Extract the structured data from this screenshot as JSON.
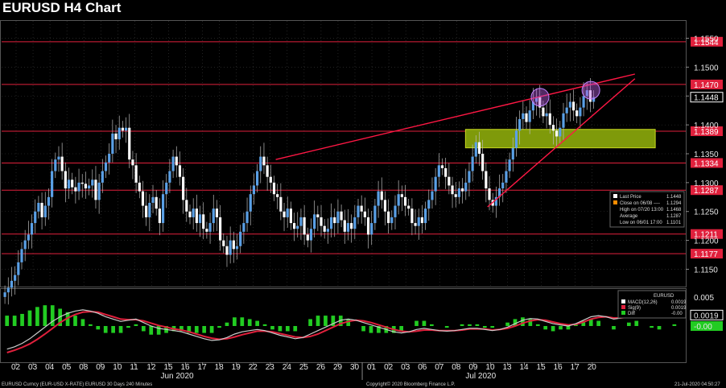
{
  "title": "EURUSD H4 Chart",
  "chart_data": {
    "type": "candlestick",
    "symbol": "EURUSD",
    "timeframe": "H4",
    "y_range": [
      1.112,
      1.158
    ],
    "y_ticks": [
      "1.1150",
      "1.1200",
      "1.1250",
      "1.1300",
      "1.1350",
      "1.1400",
      "1.1450",
      "1.1500",
      "1.1550"
    ],
    "x_ticks": [
      "02",
      "03",
      "04",
      "05",
      "08",
      "09",
      "10",
      "11",
      "12",
      "15",
      "16",
      "17",
      "18",
      "19",
      "22",
      "23",
      "24",
      "25",
      "26",
      "29",
      "30",
      "01",
      "02",
      "03",
      "06",
      "07",
      "08",
      "09",
      "10",
      "13",
      "14",
      "15",
      "16",
      "17",
      "20"
    ],
    "month_labels": [
      {
        "text": "Jun 2020",
        "day_index": 9
      },
      {
        "text": "Jul 2020",
        "day_index": 27
      }
    ],
    "horizontal_levels": [
      {
        "label": "1.1544",
        "value": 1.1544,
        "color": "#e0203c"
      },
      {
        "label": "1.1470",
        "value": 1.147,
        "color": "#e0203c"
      },
      {
        "label": "1.1389",
        "value": 1.1389,
        "color": "#e0203c"
      },
      {
        "label": "1.1334",
        "value": 1.1334,
        "color": "#e0203c"
      },
      {
        "label": "1.1287",
        "value": 1.1287,
        "color": "#e0203c"
      },
      {
        "label": "1.1211",
        "value": 1.1211,
        "color": "#e0203c"
      },
      {
        "label": "1.1177",
        "value": 1.1177,
        "color": "#e0203c"
      }
    ],
    "last_price": {
      "label": "1.1448",
      "value": 1.1448
    },
    "trendlines": [
      {
        "from": {
          "day_index": 15.8,
          "value": 1.134
        },
        "to": {
          "day_index": 37.0,
          "value": 1.1488
        }
      },
      {
        "from": {
          "day_index": 28.3,
          "value": 1.1258
        },
        "to": {
          "day_index": 37.0,
          "value": 1.148
        }
      }
    ],
    "support_zone": {
      "from_day_index": 27.0,
      "to_day_index": 38.2,
      "low": 1.137,
      "high": 1.1388,
      "color": "#7f9a0a"
    },
    "highlight_circles": [
      {
        "day_index": 31.4,
        "value": 1.1448
      },
      {
        "day_index": 34.4,
        "value": 1.146
      }
    ],
    "close_series": [
      1.111,
      1.1118,
      1.113,
      1.114,
      1.1162,
      1.1185,
      1.12,
      1.121,
      1.123,
      1.125,
      1.1265,
      1.124,
      1.126,
      1.1275,
      1.132,
      1.134,
      1.1345,
      1.132,
      1.129,
      1.1305,
      1.1292,
      1.1285,
      1.13,
      1.1298,
      1.129,
      1.1295,
      1.1305,
      1.127,
      1.13,
      1.132,
      1.1335,
      1.135,
      1.1385,
      1.1375,
      1.1395,
      1.139,
      1.1395,
      1.134,
      1.133,
      1.13,
      1.1285,
      1.126,
      1.124,
      1.1265,
      1.1275,
      1.1255,
      1.123,
      1.128,
      1.13,
      1.132,
      1.1345,
      1.133,
      1.131,
      1.127,
      1.125,
      1.124,
      1.1255,
      1.123,
      1.1245,
      1.122,
      1.1215,
      1.123,
      1.1255,
      1.124,
      1.12,
      1.119,
      1.1175,
      1.12,
      1.1185,
      1.119,
      1.1215,
      1.123,
      1.125,
      1.128,
      1.1295,
      1.132,
      1.1345,
      1.133,
      1.131,
      1.13,
      1.128,
      1.1275,
      1.125,
      1.124,
      1.1255,
      1.123,
      1.122,
      1.1225,
      1.124,
      1.121,
      1.12,
      1.122,
      1.1245,
      1.124,
      1.1225,
      1.1215,
      1.122,
      1.124,
      1.123,
      1.125,
      1.1235,
      1.1215,
      1.123,
      1.122,
      1.124,
      1.126,
      1.125,
      1.124,
      1.121,
      1.123,
      1.126,
      1.1285,
      1.127,
      1.125,
      1.123,
      1.124,
      1.126,
      1.128,
      1.1275,
      1.126,
      1.1255,
      1.123,
      1.1225,
      1.124,
      1.123,
      1.1255,
      1.127,
      1.1285,
      1.131,
      1.133,
      1.1325,
      1.131,
      1.1295,
      1.128,
      1.1275,
      1.129,
      1.1285,
      1.13,
      1.132,
      1.1345,
      1.137,
      1.135,
      1.132,
      1.129,
      1.127,
      1.126,
      1.1275,
      1.129,
      1.13,
      1.132,
      1.134,
      1.136,
      1.139,
      1.141,
      1.142,
      1.1405,
      1.1425,
      1.144,
      1.1448,
      1.143,
      1.1415,
      1.142,
      1.14,
      1.139,
      1.138,
      1.1395,
      1.142,
      1.143,
      1.144,
      1.1425,
      1.1415,
      1.143,
      1.145,
      1.146,
      1.144,
      1.1448
    ],
    "macd_axis": [
      {
        "label": "0.005",
        "value": 0.005
      },
      {
        "label": "0.0019",
        "value": 0.0019
      },
      {
        "label": "-0.00",
        "value": 0.0
      }
    ],
    "macd_series": [
      -0.004,
      -0.0036,
      -0.003,
      -0.0022,
      -0.0012,
      -0.0002,
      0.0008,
      0.0016,
      0.0022,
      0.0026,
      0.0028,
      0.0026,
      0.0022,
      0.0016,
      0.0012,
      0.0008,
      0.001,
      0.0012,
      0.0006,
      0.0,
      -0.0004,
      -0.0006,
      -0.0008,
      -0.001,
      -0.0014,
      -0.0018,
      -0.0022,
      -0.0025,
      -0.0024,
      -0.002,
      -0.0014,
      -0.001,
      -0.0008,
      -0.0006,
      -0.0008,
      -0.0012,
      -0.0016,
      -0.0019,
      -0.0022,
      -0.002,
      -0.0014,
      -0.0008,
      -0.0002,
      0.0004,
      0.001,
      0.0012,
      0.001,
      0.0006,
      0.0002,
      -0.0002,
      -0.0006,
      -0.001,
      -0.0012,
      -0.001,
      -0.0006,
      -0.0004,
      -0.0006,
      -0.0008,
      -0.0009,
      -0.0008,
      -0.0006,
      -0.0004,
      -0.0004,
      -0.0006,
      -0.0008,
      -0.0006,
      -0.0002,
      0.0004,
      0.001,
      0.0013,
      0.0012,
      0.0008,
      0.0004,
      0.0002,
      0.0,
      0.0004,
      0.001,
      0.0016,
      0.0018,
      0.0016,
      0.0012,
      0.0014,
      0.0018,
      0.0022,
      0.002,
      0.0018,
      0.0016,
      0.0018,
      0.002,
      0.0019
    ],
    "signal_series": [
      -0.0046,
      -0.0042,
      -0.0037,
      -0.0031,
      -0.0023,
      -0.0014,
      -0.0004,
      0.0006,
      0.0014,
      0.002,
      0.0024,
      0.0025,
      0.0024,
      0.002,
      0.0016,
      0.0012,
      0.0011,
      0.0011,
      0.0009,
      0.0005,
      0.0001,
      -0.0002,
      -0.0005,
      -0.0007,
      -0.001,
      -0.0014,
      -0.0018,
      -0.0021,
      -0.0023,
      -0.0022,
      -0.0019,
      -0.0015,
      -0.0012,
      -0.0009,
      -0.0009,
      -0.001,
      -0.0013,
      -0.0016,
      -0.0019,
      -0.002,
      -0.0018,
      -0.0014,
      -0.0008,
      -0.0002,
      0.0004,
      0.0008,
      0.001,
      0.0009,
      0.0006,
      0.0002,
      -0.0002,
      -0.0006,
      -0.0009,
      -0.001,
      -0.0009,
      -0.0007,
      -0.0007,
      -0.0008,
      -0.0008,
      -0.0008,
      -0.0007,
      -0.0005,
      -0.0005,
      -0.0005,
      -0.0007,
      -0.0006,
      -0.0004,
      0.0,
      0.0005,
      0.0009,
      0.0011,
      0.001,
      0.0007,
      0.0004,
      0.0002,
      0.0003,
      0.0007,
      0.0012,
      0.0015,
      0.0016,
      0.0014,
      0.0014,
      0.0016,
      0.0019,
      0.002,
      0.0019,
      0.0018,
      0.0018,
      0.0019,
      0.0019
    ],
    "legend_price": [
      {
        "label": "Last Price",
        "value": "1.1448",
        "swatch": "#ffffff"
      },
      {
        "label": "Close on 06/08 ---- ",
        "value": "1.1294",
        "swatch": "#ff8c00"
      },
      {
        "label": "High on 07/20 13:00",
        "value": "1.1468",
        "swatch": ""
      },
      {
        "label": "Average",
        "value": "1.1287",
        "swatch": ""
      },
      {
        "label": "Low on 06/01 17:00",
        "value": "1.1101",
        "swatch": ""
      }
    ],
    "legend_macd_title": "EURUSD",
    "legend_macd": [
      {
        "label": "MACD(12,26)",
        "value": "0.0019",
        "swatch": "#ffffff"
      },
      {
        "label": "Sig(9)",
        "value": "0.0019",
        "swatch": "#e0203c"
      },
      {
        "label": "Diff",
        "value": "-0.00",
        "swatch": "#22cc22"
      }
    ]
  },
  "footer": {
    "left": "EURUSD Curncy (EUR-USD X-RATE) EURUSD 30 Days 240 Minutes",
    "center": "Copyright© 2020 Bloomberg Finance L.P.",
    "right": "21-Jul-2020 04:50:27"
  },
  "colors": {
    "up": "#5aa0e6",
    "down": "#ffffff",
    "level": "#e0203c",
    "grid": "#3a3a3a"
  }
}
